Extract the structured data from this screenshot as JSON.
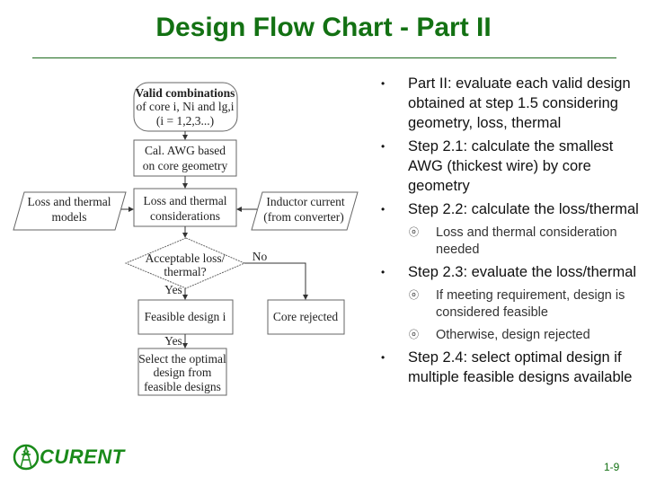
{
  "title": "Design Flow Chart - Part II",
  "flowchart": {
    "start": [
      "Valid combinations",
      "of core i, Ni and lg,i",
      "(i = 1,2,3...)"
    ],
    "awg": [
      "Cal. AWG based",
      "on core geometry"
    ],
    "loss_models": [
      "Loss and thermal",
      "models"
    ],
    "loss_consider": [
      "Loss and thermal",
      "considerations"
    ],
    "inductor": [
      "Inductor current",
      "(from converter)"
    ],
    "decision": [
      "Acceptable loss/",
      "thermal?"
    ],
    "no_label": "No",
    "yes_label": "Yes",
    "yes_label2": "Yes",
    "feasible": "Feasible design i",
    "rejected": "Core rejected",
    "select": [
      "Select the optimal",
      "design from",
      "feasible designs"
    ]
  },
  "bullets": [
    {
      "level": 1,
      "text": "Part II: evaluate each valid design obtained at step 1.5 considering geometry, loss, thermal"
    },
    {
      "level": 1,
      "text": "Step 2.1: calculate the smallest AWG (thickest wire) by core geometry"
    },
    {
      "level": 1,
      "text": "Step 2.2: calculate the loss/thermal"
    },
    {
      "level": 2,
      "text": "Loss and thermal consideration needed"
    },
    {
      "level": 1,
      "text": "Step 2.3: evaluate the loss/thermal"
    },
    {
      "level": 2,
      "text": "If meeting requirement, design is considered feasible"
    },
    {
      "level": 2,
      "text": "Otherwise, design rejected"
    },
    {
      "level": 1,
      "text": "Step 2.4: select optimal design if multiple feasible designs available"
    }
  ],
  "markers": {
    "level1": "•",
    "level2": "ⓞ"
  },
  "logo_text": "CURENT",
  "page_number": "1-9"
}
